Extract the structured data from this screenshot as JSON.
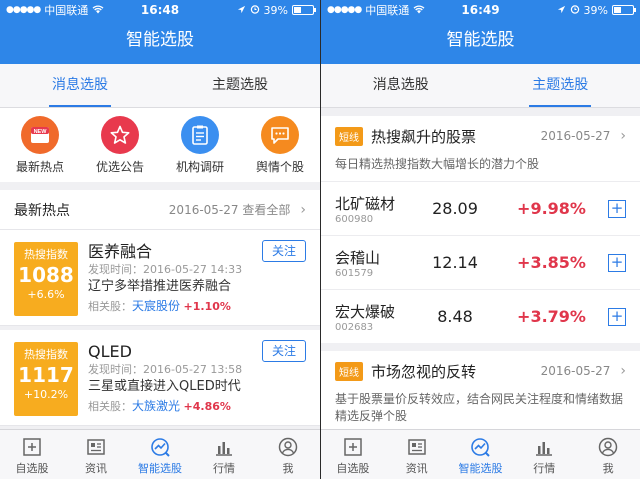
{
  "status": {
    "left": {
      "carrier": "中国联通",
      "dots": "●●●●●"
    },
    "left_time": "16:48",
    "right_time": "16:49",
    "battery": "39%",
    "battery_level": 0.39
  },
  "header": {
    "title": "智能选股"
  },
  "tabs": [
    {
      "label": "消息选股"
    },
    {
      "label": "主题选股"
    }
  ],
  "left": {
    "icons": [
      {
        "label": "最新热点",
        "icon": "new-icon",
        "badge": "NEW",
        "color": "#f06a2b"
      },
      {
        "label": "优选公告",
        "icon": "star-icon",
        "color": "#e8394d"
      },
      {
        "label": "机构调研",
        "icon": "clipboard-icon",
        "color": "#3b8ff0"
      },
      {
        "label": "舆情个股",
        "icon": "chat-icon",
        "color": "#f58a1f"
      }
    ],
    "section": {
      "title": "最新热点",
      "date": "2016-05-27",
      "view_all": "查看全部"
    },
    "news": [
      {
        "heat_label": "热搜指数",
        "heat": "1088",
        "heat_change": "+6.6%",
        "title": "医养融合",
        "time": "发现时间：2016-05-27 14:33",
        "desc": "辽宁多举措推进医养融合",
        "rel_label": "相关股：",
        "stock": "天宸股份",
        "change": "+1.10%",
        "follow": "关注"
      },
      {
        "heat_label": "热搜指数",
        "heat": "1117",
        "heat_change": "+10.2%",
        "title": "QLED",
        "time": "发现时间：2016-05-27 13:58",
        "desc": "三星或直接进入QLED时代",
        "rel_label": "相关股：",
        "stock": "大族激光",
        "change": "+4.86%",
        "follow": "关注"
      }
    ]
  },
  "right": {
    "card1": {
      "tag": "短线",
      "title": "热搜飙升的股票",
      "date": "2016-05-27",
      "subtitle": "每日精选热搜指数大幅增长的潜力个股",
      "stocks": [
        {
          "name": "北矿磁材",
          "code": "600980",
          "price": "28.09",
          "change": "+9.98%"
        },
        {
          "name": "会稽山",
          "code": "601579",
          "price": "12.14",
          "change": "+3.85%"
        },
        {
          "name": "宏大爆破",
          "code": "002683",
          "price": "8.48",
          "change": "+3.79%"
        }
      ]
    },
    "card2": {
      "tag": "短线",
      "title": "市场忽视的反转",
      "date": "2016-05-27",
      "subtitle": "基于股票量价反转效应，结合网民关注程度和情绪数据精选反弹个股"
    }
  },
  "bottom": [
    {
      "label": "自选股",
      "icon": "plus-box-icon"
    },
    {
      "label": "资讯",
      "icon": "news-icon"
    },
    {
      "label": "智能选股",
      "icon": "smart-select-icon"
    },
    {
      "label": "行情",
      "icon": "bar-chart-icon"
    },
    {
      "label": "我",
      "icon": "user-icon"
    }
  ],
  "accent": "#2c7be5",
  "header_color": "#2e86e8"
}
